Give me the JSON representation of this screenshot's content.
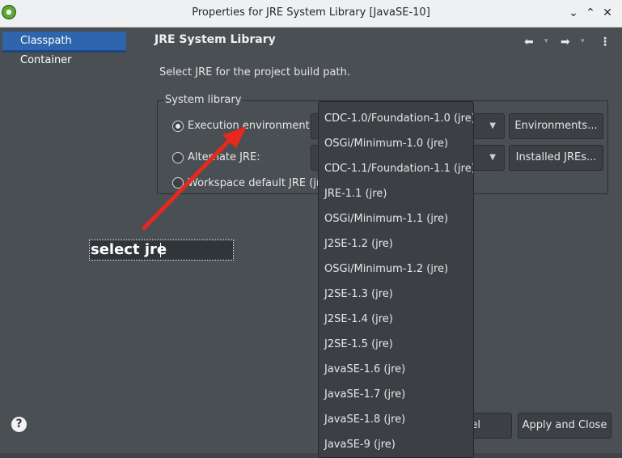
{
  "window": {
    "title": "Properties for JRE System Library [JavaSE-10]",
    "controls": {
      "help": "?",
      "minimize": "⌄",
      "maximize": "⌃",
      "close": "✕"
    }
  },
  "sidebar": {
    "items": [
      {
        "label": "Classpath Container",
        "selected": true
      }
    ]
  },
  "header": {
    "title": "JRE System Library",
    "nav": {
      "back": "⬅",
      "forward": "➡",
      "menu": "⋮",
      "back_caret": "▾",
      "forward_caret": "▾"
    }
  },
  "description": "Select JRE for the project build path.",
  "system_library": {
    "label": "System library",
    "options": [
      {
        "label": "Execution environment:",
        "checked": true,
        "button": "Environments..."
      },
      {
        "label": "Alternate JRE:",
        "checked": false,
        "button": "Installed JREs..."
      },
      {
        "label": "Workspace default JRE (jre",
        "checked": false
      }
    ]
  },
  "dropdown": {
    "items": [
      "CDC-1.0/Foundation-1.0 (jre)",
      "OSGi/Minimum-1.0 (jre)",
      "CDC-1.1/Foundation-1.1 (jre)",
      "JRE-1.1 (jre)",
      "OSGi/Minimum-1.1 (jre)",
      "J2SE-1.2 (jre)",
      "OSGi/Minimum-1.2 (jre)",
      "J2SE-1.3 (jre)",
      "J2SE-1.4 (jre)",
      "J2SE-1.5 (jre)",
      "JavaSE-1.6 (jre)",
      "JavaSE-1.7 (jre)",
      "JavaSE-1.8 (jre)",
      "JavaSE-9 (jre)"
    ]
  },
  "annotation": {
    "text": "select jre",
    "arrow_color": "#e8281e"
  },
  "footer": {
    "cancel_label": "el",
    "apply_close_label": "Apply and Close",
    "help_icon": "?"
  },
  "colors": {
    "accent": "#2f65ad",
    "background": "#4a4f54",
    "control": "#3c4045"
  }
}
